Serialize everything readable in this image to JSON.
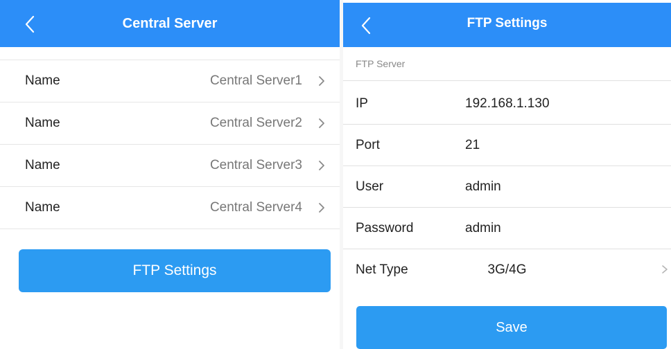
{
  "central": {
    "title": "Central Server",
    "rows": [
      {
        "label": "Name",
        "value": "Central Server1"
      },
      {
        "label": "Name",
        "value": "Central Server2"
      },
      {
        "label": "Name",
        "value": "Central Server3"
      },
      {
        "label": "Name",
        "value": "Central Server4"
      }
    ],
    "ftp_button": "FTP Settings"
  },
  "ftp": {
    "title": "FTP Settings",
    "section": "FTP Server",
    "ip_label": "IP",
    "ip_value": "192.168.1.130",
    "port_label": "Port",
    "port_value": "21",
    "user_label": "User",
    "user_value": "admin",
    "password_label": "Password",
    "password_value": "admin",
    "net_label": "Net Type",
    "net_value": "3G/4G",
    "save_button": "Save"
  },
  "colors": {
    "header": "#2c8ef8",
    "button": "#2c9bf2"
  },
  "icons": {
    "back": "chevron-left-icon",
    "row": "chevron-right-icon"
  }
}
